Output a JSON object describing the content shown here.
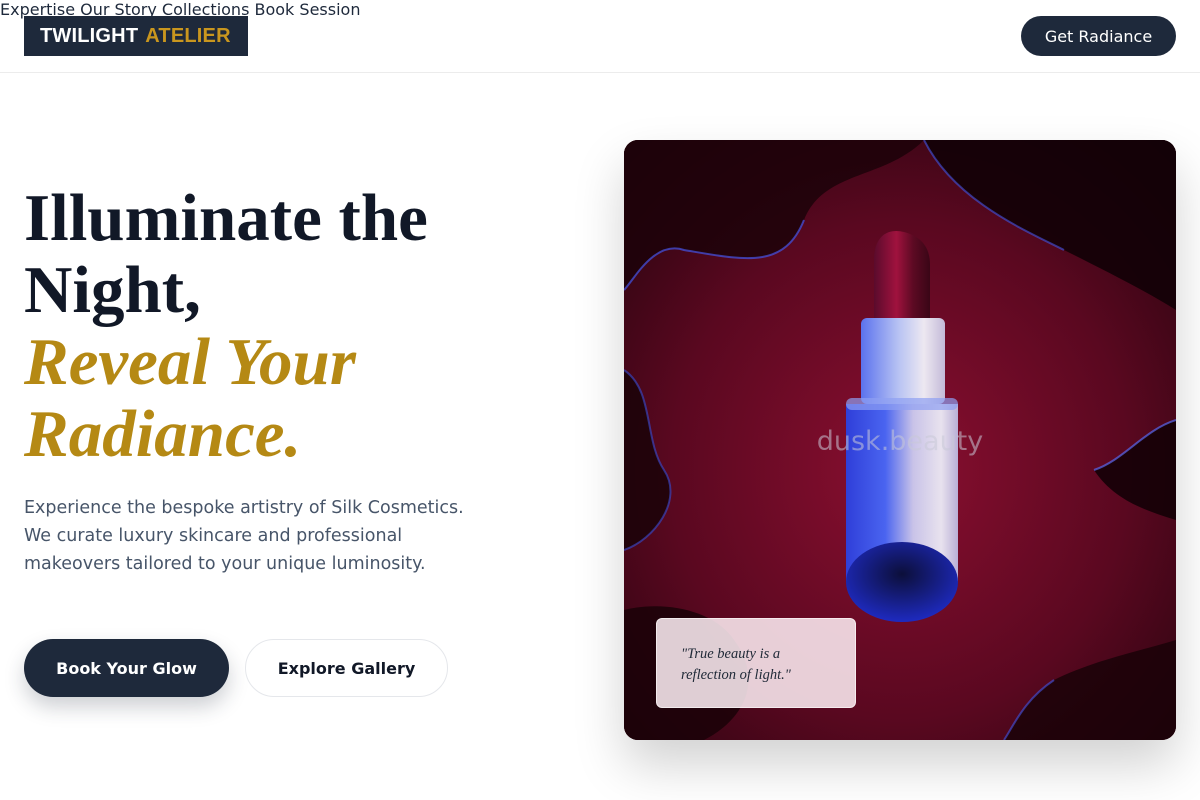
{
  "brand": {
    "name_part1": "TWILIGHT",
    "name_part2": "ATELIER"
  },
  "nav": {
    "items": [
      {
        "label": "Expertise"
      },
      {
        "label": "Our Story"
      },
      {
        "label": "Collections"
      },
      {
        "label": "Book Session"
      }
    ],
    "cta_label": "Get Radiance"
  },
  "hero": {
    "headline_line1": "Illuminate the",
    "headline_line2": "Night,",
    "headline_accent1": "Reveal Your",
    "headline_accent2": "Radiance.",
    "description": "Experience the bespoke artistry of Silk Cosmetics. We curate luxury skincare and professional makeovers tailored to your unique luminosity.",
    "primary_button": "Book Your Glow",
    "secondary_button": "Explore Gallery"
  },
  "image": {
    "watermark": "dusk.beauty",
    "quote": "\"True beauty is a reflection of light.\""
  },
  "colors": {
    "navy": "#1e293b",
    "gold": "#b58914",
    "crimson": "#6b0a24"
  }
}
